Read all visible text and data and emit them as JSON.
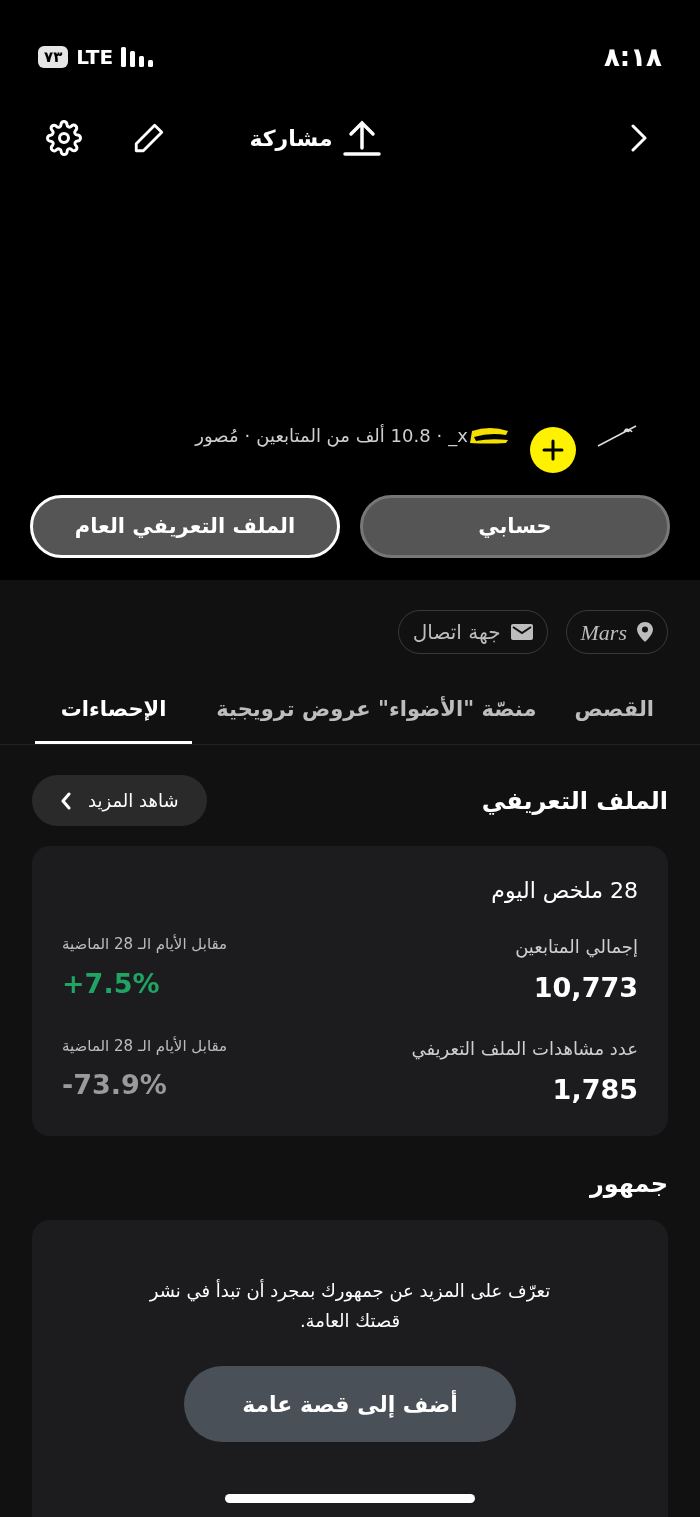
{
  "status_bar": {
    "time": "٨:١٨",
    "network": "LTE",
    "battery": "٧٣"
  },
  "header": {
    "share_label": "مشاركة"
  },
  "profile": {
    "subtitle_parts": [
      "x_",
      "·",
      "10.8 ألف من المتابعين",
      "·",
      "مُصور"
    ]
  },
  "profile_buttons": [
    {
      "label": "حسابي",
      "selected": false
    },
    {
      "label": "الملف التعريفي العام",
      "selected": true
    }
  ],
  "chips": [
    {
      "kind": "location",
      "label": "Mars"
    },
    {
      "kind": "contact",
      "label": "جهة اتصال"
    }
  ],
  "tabs": [
    {
      "label": "القصص",
      "selected": false
    },
    {
      "label": "منصّة \"الأضواء\" عروض ترويجية",
      "selected": false
    },
    {
      "label": "الإحصاءات",
      "selected": true
    }
  ],
  "profile_section": {
    "title": "الملف التعريفي",
    "see_more": "شاهد المزيد",
    "card_title": "28 ملخص اليوم",
    "stats": [
      {
        "label": "إجمالي المتابعين",
        "value": "10,773",
        "compare": "مقابل الأيام الـ 28 الماضية",
        "change": "+7.5%",
        "color": "#1fa463"
      },
      {
        "label": "عدد مشاهدات الملف التعريفي",
        "value": "1,785",
        "compare": "مقابل الأيام الـ 28 الماضية",
        "change": "-73.9%",
        "color": "#9a9a9a"
      }
    ]
  },
  "audience": {
    "title": "جمهور",
    "message": "تعرّف على المزيد عن جمهورك بمجرد أن تبدأ في نشر قصتك العامة.",
    "button": "أضف إلى قصة عامة"
  }
}
